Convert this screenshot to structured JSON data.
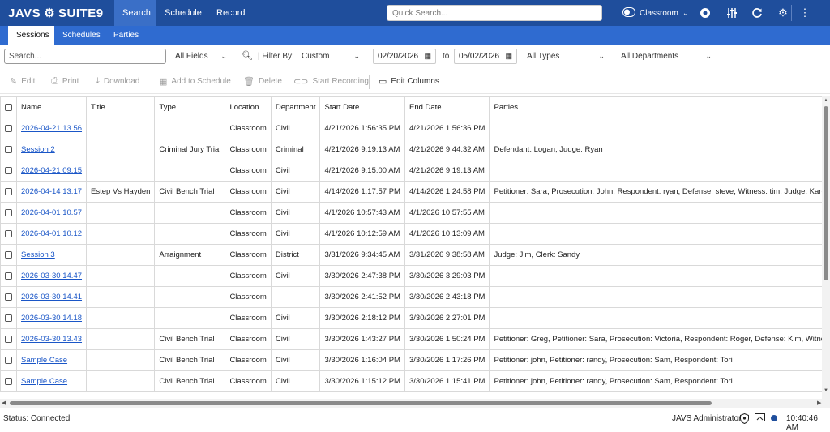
{
  "app": {
    "logo_left": "JAVS",
    "logo_right": "SUITE9",
    "nav": [
      "Search",
      "Schedule",
      "Record"
    ],
    "quick_search_placeholder": "Quick Search...",
    "room": "Classroom",
    "accent_color": "#1f4e9c"
  },
  "subnav": [
    "Sessions",
    "Schedules",
    "Parties"
  ],
  "filters": {
    "search_placeholder": "Search...",
    "field_scope": "All Fields",
    "filter_by_label": "| Filter By:",
    "filter_mode": "Custom",
    "date_from": "02/20/2026",
    "to_label": "to",
    "date_to": "05/02/2026",
    "types": "All Types",
    "departments": "All Departments"
  },
  "toolbar": {
    "edit": "Edit",
    "print": "Print",
    "download": "Download",
    "add_to_schedule": "Add to Schedule",
    "delete": "Delete",
    "start_recording": "Start Recording",
    "edit_columns": "Edit Columns"
  },
  "table": {
    "columns": [
      "Name",
      "Title",
      "Type",
      "Location",
      "Department",
      "Start Date",
      "End Date",
      "Parties"
    ],
    "rows": [
      {
        "name": "2026-04-21 13.56",
        "title": "",
        "type": "",
        "location": "Classroom",
        "department": "Civil",
        "start": "4/21/2026 1:56:35 PM",
        "end": "4/21/2026 1:56:36 PM",
        "parties": ""
      },
      {
        "name": "Session 2",
        "title": "",
        "type": "Criminal Jury Trial",
        "location": "Classroom",
        "department": "Criminal",
        "start": "4/21/2026 9:19:13 AM",
        "end": "4/21/2026 9:44:32 AM",
        "parties": "Defendant: Logan, Judge: Ryan"
      },
      {
        "name": "2026-04-21 09.15",
        "title": "",
        "type": "",
        "location": "Classroom",
        "department": "Civil",
        "start": "4/21/2026 9:15:00 AM",
        "end": "4/21/2026 9:19:13 AM",
        "parties": ""
      },
      {
        "name": "2026-04-14 13.17",
        "title": "Estep Vs Hayden",
        "type": "Civil Bench Trial",
        "location": "Classroom",
        "department": "Civil",
        "start": "4/14/2026 1:17:57 PM",
        "end": "4/14/2026 1:24:58 PM",
        "parties": "Petitioner: Sara, Prosecution: John, Respondent: ryan, Defense: steve, Witness: tim, Judge: Karen"
      },
      {
        "name": "2026-04-01 10.57",
        "title": "",
        "type": "",
        "location": "Classroom",
        "department": "Civil",
        "start": "4/1/2026 10:57:43 AM",
        "end": "4/1/2026 10:57:55 AM",
        "parties": ""
      },
      {
        "name": "2026-04-01 10.12",
        "title": "",
        "type": "",
        "location": "Classroom",
        "department": "Civil",
        "start": "4/1/2026 10:12:59 AM",
        "end": "4/1/2026 10:13:09 AM",
        "parties": ""
      },
      {
        "name": "Session 3",
        "title": "",
        "type": "Arraignment",
        "location": "Classroom",
        "department": "District",
        "start": "3/31/2026 9:34:45 AM",
        "end": "3/31/2026 9:38:58 AM",
        "parties": "Judge: Jim, Clerk: Sandy"
      },
      {
        "name": "2026-03-30 14.47",
        "title": "",
        "type": "",
        "location": "Classroom",
        "department": "Civil",
        "start": "3/30/2026 2:47:38 PM",
        "end": "3/30/2026 3:29:03 PM",
        "parties": ""
      },
      {
        "name": "2026-03-30 14.41",
        "title": "",
        "type": "",
        "location": "Classroom",
        "department": "",
        "start": "3/30/2026 2:41:52 PM",
        "end": "3/30/2026 2:43:18 PM",
        "parties": ""
      },
      {
        "name": "2026-03-30 14.18",
        "title": "",
        "type": "",
        "location": "Classroom",
        "department": "Civil",
        "start": "3/30/2026 2:18:12 PM",
        "end": "3/30/2026 2:27:01 PM",
        "parties": ""
      },
      {
        "name": "2026-03-30 13.43",
        "title": "",
        "type": "Civil Bench Trial",
        "location": "Classroom",
        "department": "Civil",
        "start": "3/30/2026 1:43:27 PM",
        "end": "3/30/2026 1:50:24 PM",
        "parties": "Petitioner: Greg, Petitioner: Sara, Prosecution: Victoria, Respondent: Roger, Defense: Kim, Witness: Jim"
      },
      {
        "name": "Sample Case",
        "title": "",
        "type": "Civil Bench Trial",
        "location": "Classroom",
        "department": "Civil",
        "start": "3/30/2026 1:16:04 PM",
        "end": "3/30/2026 1:17:26 PM",
        "parties": "Petitioner: john, Petitioner: randy, Prosecution: Sam, Respondent: Tori"
      },
      {
        "name": "Sample Case",
        "title": "",
        "type": "Civil Bench Trial",
        "location": "Classroom",
        "department": "Civil",
        "start": "3/30/2026 1:15:12 PM",
        "end": "3/30/2026 1:15:41 PM",
        "parties": "Petitioner: john, Petitioner: randy, Prosecution: Sam, Respondent: Tori"
      }
    ]
  },
  "status": {
    "text": "Status: Connected",
    "user": "JAVS Administrator",
    "time": "10:40:46 AM"
  }
}
